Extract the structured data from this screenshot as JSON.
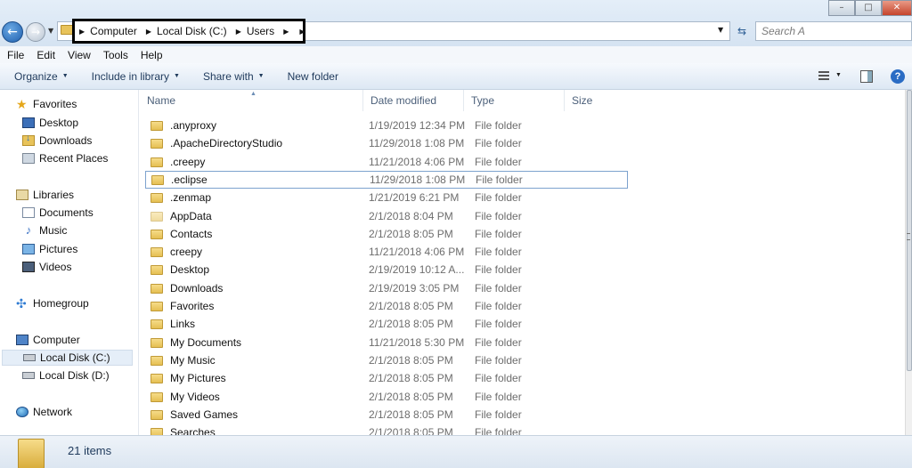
{
  "address": {
    "crumbs": [
      "Computer",
      "Local Disk (C:)",
      "Users"
    ],
    "search_placeholder": "Search A"
  },
  "window_buttons": {
    "minimize": "–",
    "maximize": "□",
    "close": "✕"
  },
  "menubar": [
    "File",
    "Edit",
    "View",
    "Tools",
    "Help"
  ],
  "toolbar": {
    "organize": "Organize",
    "include_in_library": "Include in library",
    "share_with": "Share with",
    "new_folder": "New folder"
  },
  "nav": {
    "favorites": "Favorites",
    "desktop": "Desktop",
    "downloads": "Downloads",
    "recent_places": "Recent Places",
    "libraries": "Libraries",
    "documents": "Documents",
    "music": "Music",
    "pictures": "Pictures",
    "videos": "Videos",
    "homegroup": "Homegroup",
    "computer": "Computer",
    "local_disk_c": "Local Disk (C:)",
    "local_disk_d": "Local Disk (D:)",
    "network": "Network"
  },
  "columns": {
    "name": "Name",
    "date_modified": "Date modified",
    "type": "Type",
    "size": "Size"
  },
  "files": [
    {
      "name": ".anyproxy",
      "date": "1/19/2019 12:34 PM",
      "type": "File folder"
    },
    {
      "name": ".ApacheDirectoryStudio",
      "date": "11/29/2018 1:08 PM",
      "type": "File folder"
    },
    {
      "name": ".creepy",
      "date": "11/21/2018 4:06 PM",
      "type": "File folder"
    },
    {
      "name": ".eclipse",
      "date": "11/29/2018 1:08 PM",
      "type": "File folder"
    },
    {
      "name": ".zenmap",
      "date": "1/21/2019 6:21 PM",
      "type": "File folder"
    },
    {
      "name": "AppData",
      "date": "2/1/2018 8:04 PM",
      "type": "File folder"
    },
    {
      "name": "Contacts",
      "date": "2/1/2018 8:05 PM",
      "type": "File folder"
    },
    {
      "name": "creepy",
      "date": "11/21/2018 4:06 PM",
      "type": "File folder"
    },
    {
      "name": "Desktop",
      "date": "2/19/2019 10:12 A...",
      "type": "File folder"
    },
    {
      "name": "Downloads",
      "date": "2/19/2019 3:05 PM",
      "type": "File folder"
    },
    {
      "name": "Favorites",
      "date": "2/1/2018 8:05 PM",
      "type": "File folder"
    },
    {
      "name": "Links",
      "date": "2/1/2018 8:05 PM",
      "type": "File folder"
    },
    {
      "name": "My Documents",
      "date": "11/21/2018 5:30 PM",
      "type": "File folder"
    },
    {
      "name": "My Music",
      "date": "2/1/2018 8:05 PM",
      "type": "File folder"
    },
    {
      "name": "My Pictures",
      "date": "2/1/2018 8:05 PM",
      "type": "File folder"
    },
    {
      "name": "My Videos",
      "date": "2/1/2018 8:05 PM",
      "type": "File folder"
    },
    {
      "name": "Saved Games",
      "date": "2/1/2018 8:05 PM",
      "type": "File folder"
    },
    {
      "name": "Searches",
      "date": "2/1/2018 8:05 PM",
      "type": "File folder"
    }
  ],
  "status": {
    "item_count": "21 items"
  }
}
